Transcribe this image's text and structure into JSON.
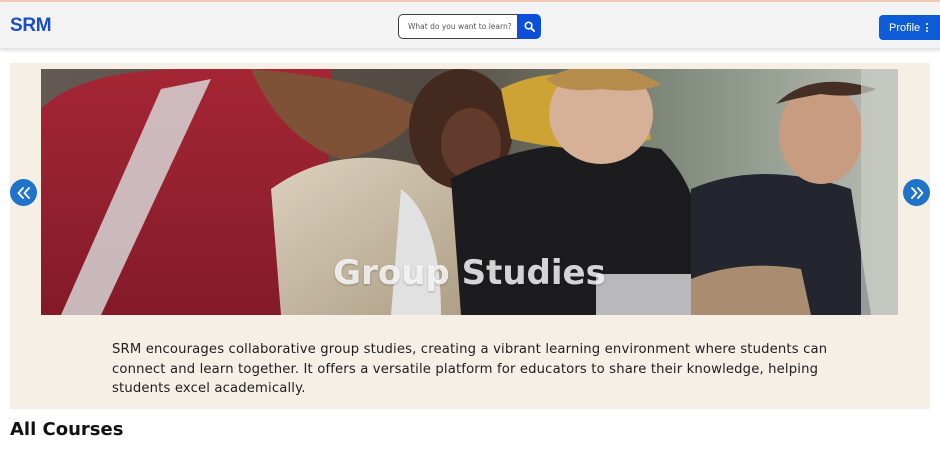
{
  "header": {
    "brand": "SRM",
    "search": {
      "placeholder": "What do you want to learn?",
      "value": "",
      "icon": "search-icon"
    },
    "profile_label": "Profile",
    "profile_icon": "kebab-menu-icon"
  },
  "carousel": {
    "slide_title": "Group Studies",
    "slide_image": "students-studying-photo",
    "caption": "SRM encourages collaborative group studies, creating a vibrant learning environment where students can connect and learn together. It offers a versatile platform for educators to share their knowledge, helping students excel academically.",
    "prev_icon": "double-chevron-left-icon",
    "next_icon": "double-chevron-right-icon"
  },
  "courses": {
    "title": "All Courses"
  },
  "colors": {
    "brand": "#1a4fc4",
    "primary_button": "#0d5bd6",
    "carousel_bg": "#f6efe6",
    "arrow": "#2173c9"
  }
}
